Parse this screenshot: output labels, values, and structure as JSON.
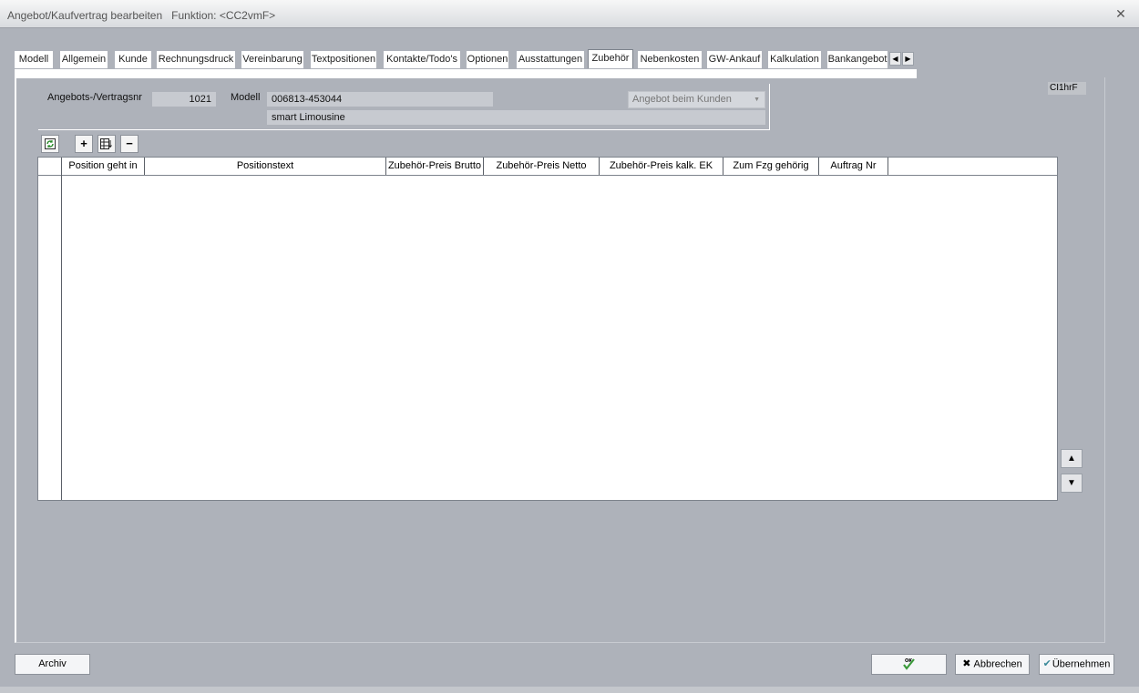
{
  "window": {
    "title": "Angebot/Kaufvertrag bearbeiten",
    "function_label": "Funktion: <CC2vmF>"
  },
  "tabs": [
    {
      "label": "Modell"
    },
    {
      "label": "Allgemein"
    },
    {
      "label": "Kunde"
    },
    {
      "label": "Rechnungsdruck"
    },
    {
      "label": "Vereinbarung"
    },
    {
      "label": "Textpositionen"
    },
    {
      "label": "Kontakte/Todo's"
    },
    {
      "label": "Optionen"
    },
    {
      "label": "Ausstattungen"
    },
    {
      "label": "Zubehör",
      "active": true
    },
    {
      "label": "Nebenkosten"
    },
    {
      "label": "GW-Ankauf"
    },
    {
      "label": "Kalkulation"
    },
    {
      "label": "Bankangebot"
    }
  ],
  "code_label": "CI1hrF",
  "header": {
    "number_label": "Angebots-/Vertragsnr",
    "number_value": "1021",
    "model_label": "Modell",
    "model_code": "006813-453044",
    "model_name": "smart Limousine",
    "status": "Angebot beim Kunden"
  },
  "grid": {
    "columns": [
      "Position geht in",
      "Positionstext",
      "Zubehör-Preis Brutto",
      "Zubehör-Preis Netto",
      "Zubehör-Preis kalk. EK",
      "Zum Fzg gehörig",
      "Auftrag Nr"
    ],
    "rows": []
  },
  "buttons": {
    "archive": "Archiv",
    "ok": "OK",
    "cancel": "Abbrechen",
    "apply": "Übernehmen"
  }
}
